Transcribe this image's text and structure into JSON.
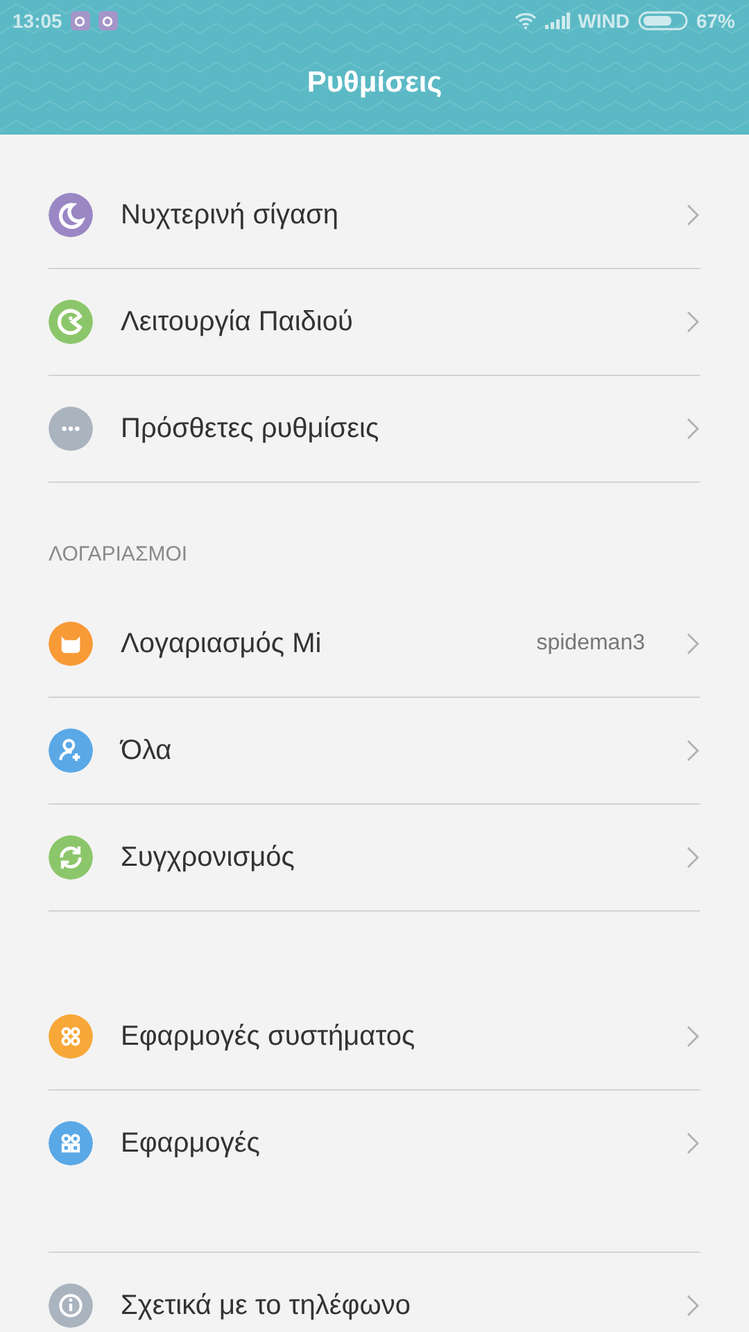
{
  "status_bar": {
    "time": "13:05",
    "carrier": "WIND",
    "battery": "67%"
  },
  "title_bar": {
    "title": "Ρυθμίσεις"
  },
  "groups": [
    {
      "items": [
        {
          "label": "Νυχτερινή σίγαση",
          "color": "#9b87c4"
        },
        {
          "label": "Λειτουργία Παιδιού",
          "color": "#8cc66b"
        },
        {
          "label": "Πρόσθετες ρυθμίσεις",
          "color": "#aab4bf"
        }
      ]
    },
    {
      "header": "ΛΟΓΑΡΙΑΣΜΟΙ",
      "items": [
        {
          "label": "Λογαριασμός Mi",
          "value": "spideman3",
          "color": "#f89a36"
        },
        {
          "label": "Όλα",
          "color": "#5aa8e6"
        },
        {
          "label": "Συγχρονισμός",
          "color": "#8cc66b"
        }
      ]
    },
    {
      "items": [
        {
          "label": "Εφαρμογές συστήματος",
          "color": "#f8a838"
        },
        {
          "label": "Εφαρμογές",
          "color": "#5aa8e6"
        }
      ]
    },
    {
      "items": [
        {
          "label": "Σχετικά με το τηλέφωνο",
          "color": "#aab4bf"
        }
      ]
    }
  ]
}
